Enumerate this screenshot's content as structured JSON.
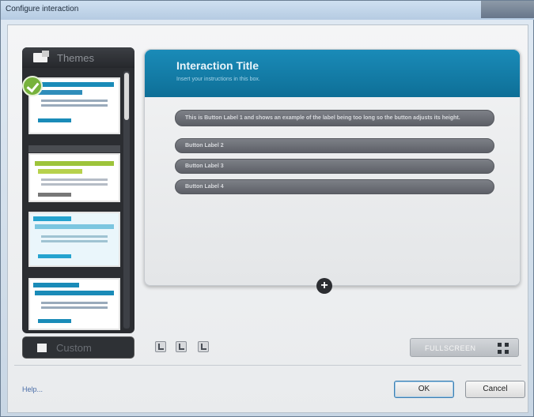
{
  "window": {
    "title": "Configure interaction"
  },
  "themes": {
    "label": "Themes",
    "items": [
      {
        "name": "theme-1",
        "selected": true,
        "accent": "#1a8bb8"
      },
      {
        "name": "theme-2",
        "selected": false,
        "accent": "#9dc43a"
      },
      {
        "name": "theme-3",
        "selected": false,
        "accent": "#25a3cf"
      },
      {
        "name": "theme-4",
        "selected": false,
        "accent": "#1a8bb8"
      }
    ]
  },
  "custom": {
    "label": "Custom"
  },
  "preview": {
    "title": "Interaction Title",
    "instructions": "Insert your instructions in this box.",
    "buttons": [
      "This is Button Label 1 and shows an example of the label being too long so the button adjusts its height.",
      "Button Label 2",
      "Button Label 3",
      "Button Label 4"
    ],
    "add_label": "+"
  },
  "toolbar": {
    "fullscreen_label": "FULLSCREEN"
  },
  "footer": {
    "help_label": "Help...",
    "ok_label": "OK",
    "cancel_label": "Cancel"
  },
  "colors": {
    "header_blue": "#1a8bb8",
    "button_gray": "#6b6e75",
    "panel_dark": "#2b2d31",
    "check_green": "#77b23c"
  }
}
